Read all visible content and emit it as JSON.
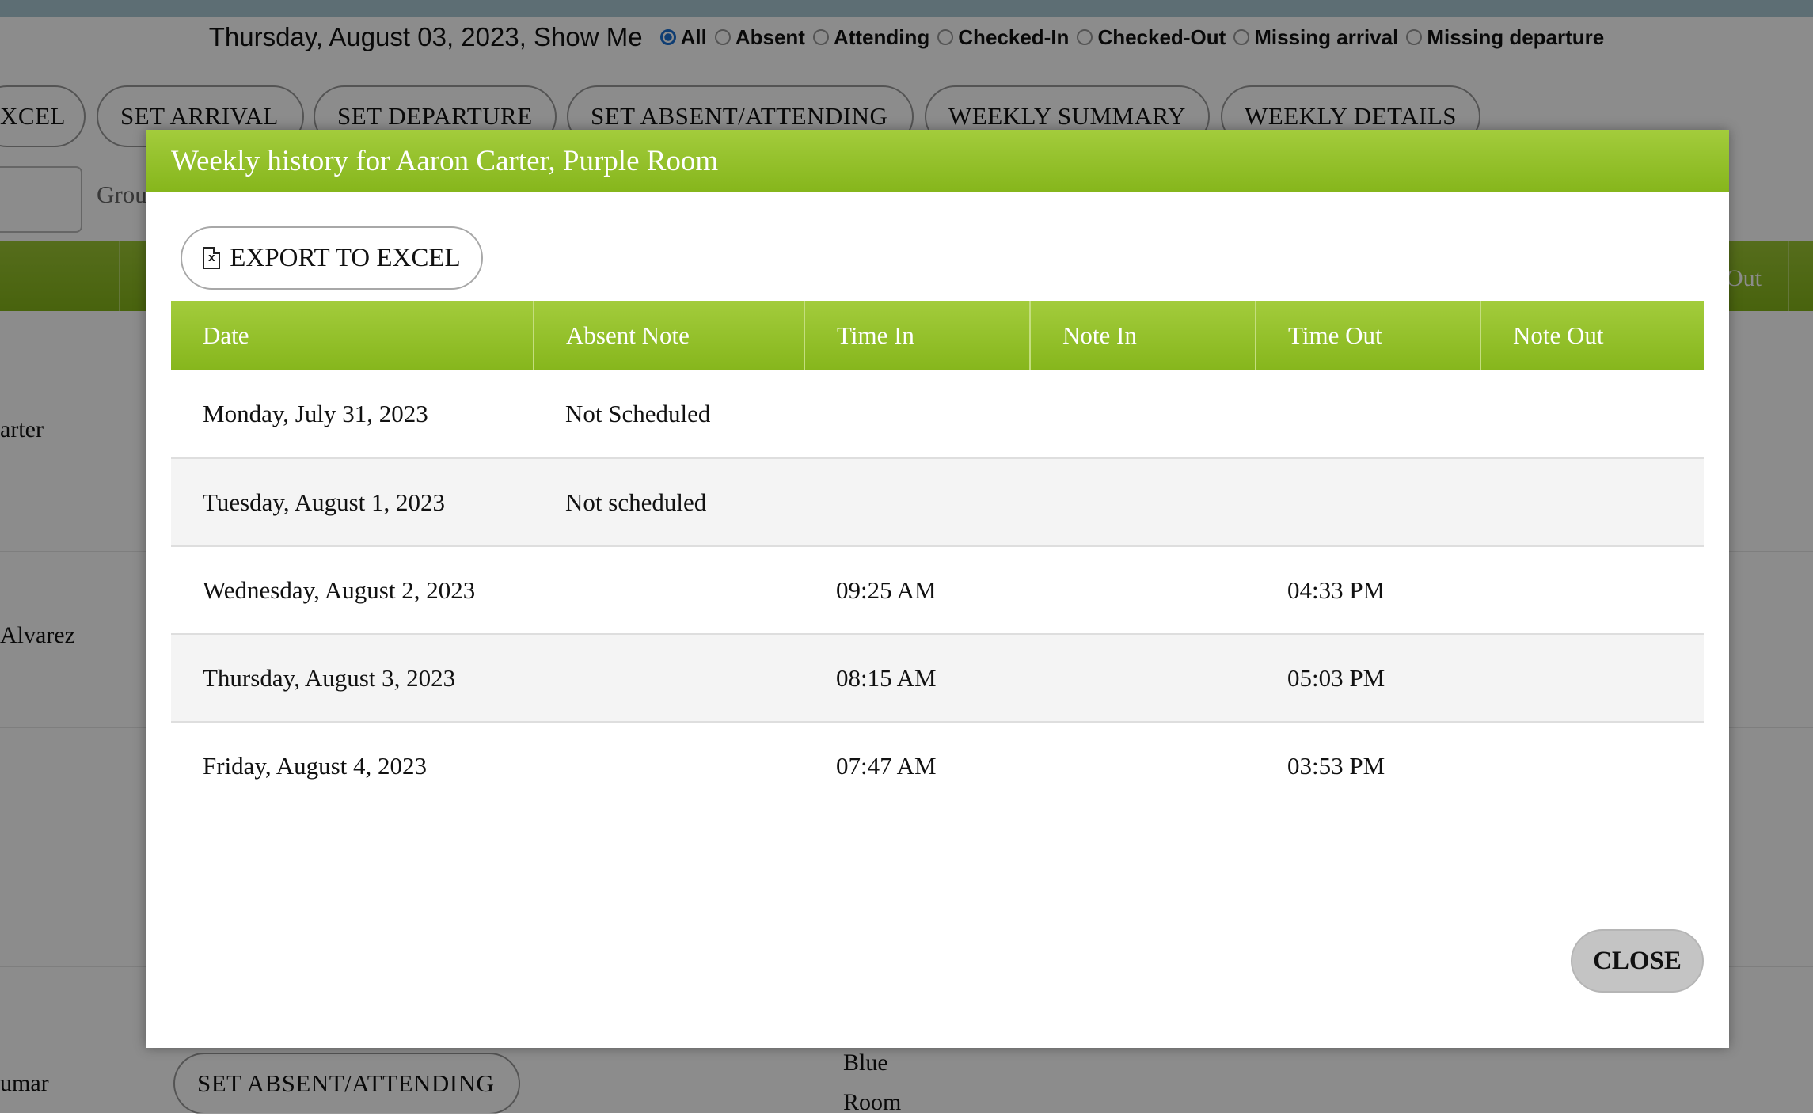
{
  "background": {
    "date_text": "Thursday, August 03, 2023, Show Me",
    "filters": [
      {
        "label": "All",
        "selected": true
      },
      {
        "label": "Absent",
        "selected": false
      },
      {
        "label": "Attending",
        "selected": false
      },
      {
        "label": "Checked-In",
        "selected": false
      },
      {
        "label": "Checked-Out",
        "selected": false
      },
      {
        "label": "Missing arrival",
        "selected": false
      },
      {
        "label": "Missing departure",
        "selected": false
      }
    ],
    "toolbar": {
      "export_partial": "XCEL",
      "set_arrival": "SET ARRIVAL",
      "set_departure": "SET DEPARTURE",
      "set_absent": "SET ABSENT/ATTENDING",
      "weekly_summary": "WEEKLY SUMMARY",
      "weekly_details": "WEEKLY DETAILS"
    },
    "group_label": "Grou",
    "header_out": "Out",
    "names": [
      "arter",
      "Alvarez",
      "umar"
    ],
    "row_button": "SET ABSENT/ATTENDING",
    "room": [
      "Blue",
      "Room"
    ]
  },
  "modal": {
    "title": "Weekly history for Aaron Carter, Purple Room",
    "export_label": "EXPORT TO EXCEL",
    "columns": [
      "Date",
      "Absent Note",
      "Time In",
      "Note In",
      "Time Out",
      "Note Out"
    ],
    "rows": [
      [
        "Monday, July 31, 2023",
        "Not Scheduled",
        "",
        "",
        "",
        ""
      ],
      [
        "Tuesday, August 1, 2023",
        "Not scheduled",
        "",
        "",
        "",
        ""
      ],
      [
        "Wednesday, August 2, 2023",
        "",
        "09:25 AM",
        "",
        "04:33 PM",
        ""
      ],
      [
        "Thursday, August 3, 2023",
        "",
        "08:15 AM",
        "",
        "05:03 PM",
        ""
      ],
      [
        "Friday, August 4, 2023",
        "",
        "07:47 AM",
        "",
        "03:53 PM",
        ""
      ]
    ],
    "close_label": "CLOSE"
  }
}
